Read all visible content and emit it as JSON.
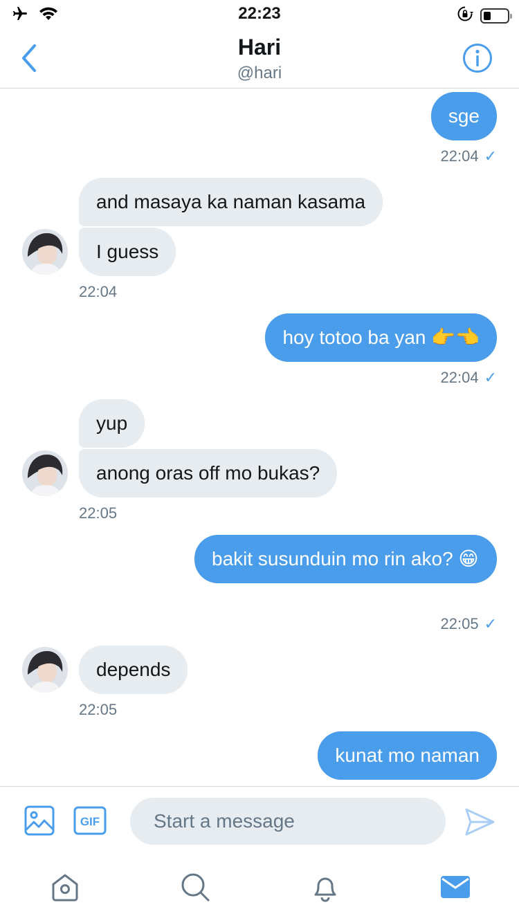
{
  "status_bar": {
    "time": "22:23",
    "icons": [
      "airplane-icon",
      "wifi-icon",
      "orientation-lock-icon",
      "battery-icon"
    ],
    "battery_level": 0.3
  },
  "header": {
    "back_icon": "chevron-left-icon",
    "title": "Hari",
    "handle": "@hari",
    "info_icon": "info-icon"
  },
  "colors": {
    "accent": "#4a9dea",
    "incoming_bubble": "#e6ecf0",
    "muted_text": "#657786"
  },
  "messages": [
    {
      "direction": "out",
      "text": "sge"
    },
    {
      "direction": "out_timestamp",
      "time": "22:04",
      "status": "✓"
    },
    {
      "direction": "in",
      "text": "and masaya ka naman kasama"
    },
    {
      "direction": "in",
      "text": "I guess"
    },
    {
      "direction": "in_timestamp",
      "time": "22:04"
    },
    {
      "direction": "out",
      "text": "hoy totoo ba yan 👉👈"
    },
    {
      "direction": "out_timestamp",
      "time": "22:04",
      "status": "✓"
    },
    {
      "direction": "in",
      "text": "yup"
    },
    {
      "direction": "in",
      "text": "anong oras off mo bukas?"
    },
    {
      "direction": "in_timestamp",
      "time": "22:05"
    },
    {
      "direction": "out",
      "text": "bakit susunduin mo rin ako? 😁"
    },
    {
      "direction": "out_timestamp",
      "time": "22:05",
      "status": "✓"
    },
    {
      "direction": "in",
      "text": "depends"
    },
    {
      "direction": "in_timestamp",
      "time": "22:05"
    },
    {
      "direction": "out",
      "text": "kunat mo naman"
    }
  ],
  "composer": {
    "media_icon": "image-icon",
    "gif_label": "GIF",
    "placeholder": "Start a message",
    "value": "",
    "send_icon": "send-icon"
  },
  "tabbar": {
    "items": [
      {
        "icon": "home-icon",
        "active": false
      },
      {
        "icon": "search-icon",
        "active": false
      },
      {
        "icon": "bell-icon",
        "active": false
      },
      {
        "icon": "mail-icon",
        "active": true
      }
    ]
  }
}
